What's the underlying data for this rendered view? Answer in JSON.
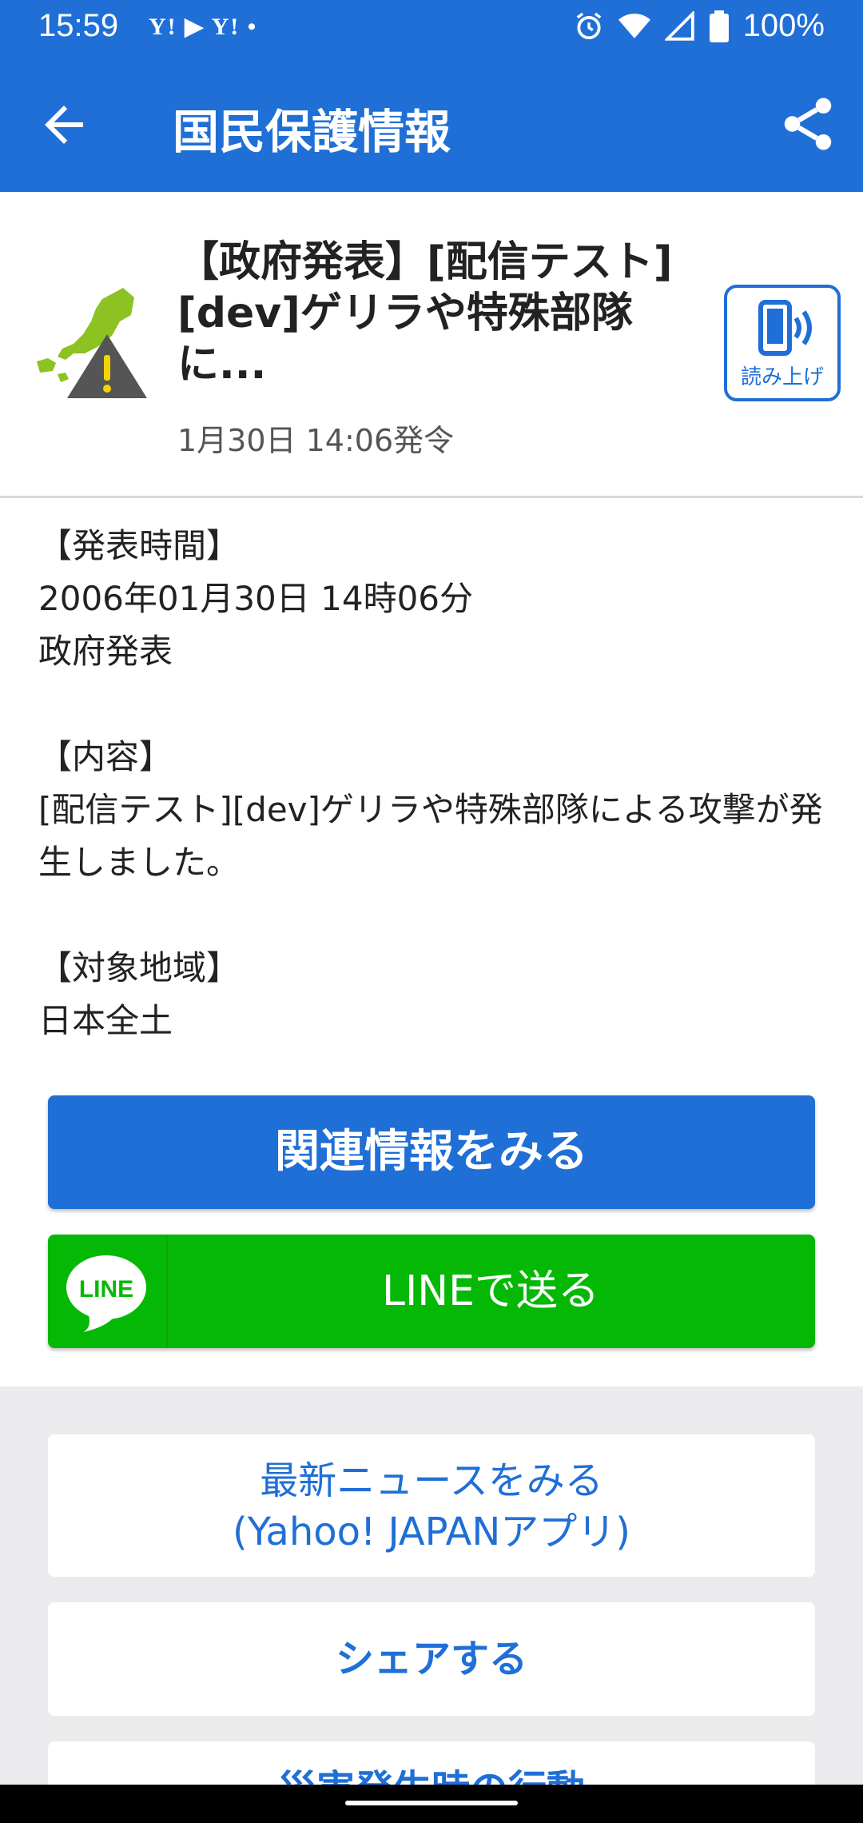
{
  "status_bar": {
    "time": "15:59",
    "notification_icons": "Y! ▶ Y! •",
    "battery": "100%"
  },
  "app_bar": {
    "title": "国民保護情報"
  },
  "alert": {
    "title": "【政府発表】[配信テスト][dev]ゲリラや特殊部隊に...",
    "issued": "1月30日 14:06発令",
    "read_aloud_label": "読み上げ"
  },
  "details": {
    "text": "【発表時間】\n2006年01月30日 14時06分\n政府発表\n\n【内容】\n[配信テスト][dev]ゲリラや特殊部隊による攻撃が発生しました。\n\n【対象地域】\n日本全土"
  },
  "buttons": {
    "related": "関連情報をみる",
    "line": "LINEで送る",
    "line_logo": "LINE"
  },
  "cards": {
    "news_line1": "最新ニュースをみる",
    "news_line2": "(Yahoo! JAPANアプリ)",
    "share": "シェアする",
    "next_partial": "災害発生時の行動"
  },
  "colors": {
    "primary": "#1f6fd6",
    "line_green": "#06b806",
    "icon_green": "#8cc221",
    "warning_yellow": "#f5d300"
  }
}
